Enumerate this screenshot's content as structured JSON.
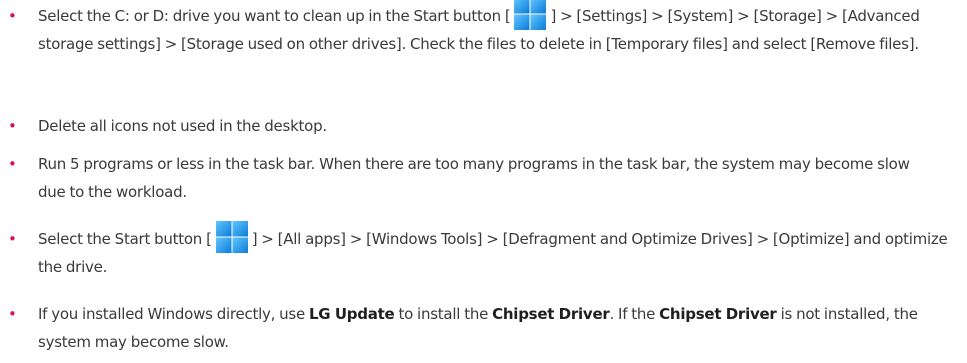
{
  "items": [
    {
      "parts": [
        "Select the C: or D: drive you want to clean up in the Start button [",
        "] > [Settings] > [System] > [Storage] > [Advanced storage settings] > [Storage used on other drives]. Check the files to delete in [Temporary files] and select [Remove files]."
      ],
      "icon": "windows-start-icon"
    },
    {
      "text": "Delete all icons not used in the desktop."
    },
    {
      "text": "Run 5 programs or less in the task bar. When there are too many programs in the task bar, the system may become slow due to the workload."
    },
    {
      "parts": [
        "Select the Start button [",
        "] > [All apps] > [Windows Tools] > [Defragment and Optimize Drives] > [Optimize] and optimize the drive."
      ],
      "icon": "windows-start-icon"
    },
    {
      "parts": [
        "If you installed Windows directly, use ",
        "LG Update",
        " to install the ",
        "Chipset Driver",
        ". If the ",
        "Chipset Driver",
        " is not installed, the system may become slow."
      ]
    }
  ],
  "bullet_char": "•",
  "colors": {
    "bullet": "#d4145a",
    "text": "#3a3a3a",
    "icon_light": "#63c6ff",
    "icon_dark": "#0a7bd8"
  }
}
